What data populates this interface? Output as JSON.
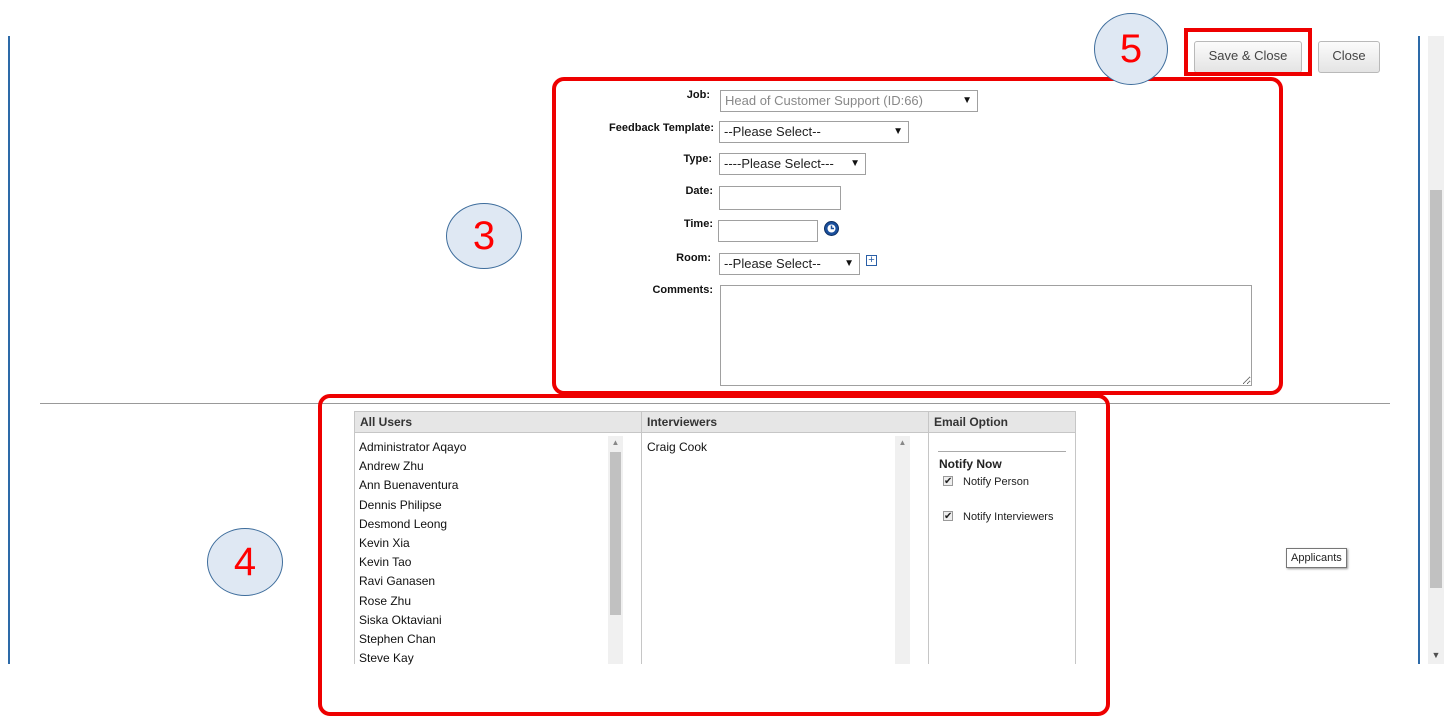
{
  "callouts": {
    "c3": "3",
    "c4": "4",
    "c5": "5"
  },
  "toolbar": {
    "save_close_label": "Save & Close",
    "close_label": "Close"
  },
  "form": {
    "job_label": "Job:",
    "job_value": "Head of Customer Support (ID:66)",
    "feedback_label": "Feedback Template:",
    "feedback_value": "--Please Select--",
    "type_label": "Type:",
    "type_value": "----Please Select---",
    "date_label": "Date:",
    "date_value": "",
    "time_label": "Time:",
    "time_value": "",
    "room_label": "Room:",
    "room_value": "--Please Select--",
    "comments_label": "Comments:",
    "comments_value": ""
  },
  "grid": {
    "all_users_header": "All Users",
    "interviewers_header": "Interviewers",
    "email_option_header": "Email Option",
    "all_users": [
      "Administrator Aqayo",
      "Andrew Zhu",
      "Ann Buenaventura",
      "Dennis Philipse",
      "Desmond Leong",
      "Kevin Xia",
      "Kevin Tao",
      "Ravi Ganasen",
      "Rose Zhu",
      "Siska Oktaviani",
      "Stephen Chan",
      "Steve Kay"
    ],
    "interviewers": [
      "Craig Cook"
    ],
    "notify_now_label": "Notify Now",
    "notify_person_label": "Notify Person",
    "notify_person_checked": true,
    "notify_interviewers_label": "Notify Interviewers",
    "notify_interviewers_checked": true
  },
  "tooltip": {
    "applicants": "Applicants"
  },
  "icons": {
    "clock": "clock-icon",
    "add": "plus-box-icon",
    "dropdown": "triangle-down-icon",
    "scroll_up": "triangle-up-icon",
    "scroll_down": "triangle-down-icon",
    "check": "checkmark-icon"
  },
  "colors": {
    "annotation": "#ee0000",
    "frame": "#2d6aa8",
    "callout_fill": "#dfe8f3"
  }
}
